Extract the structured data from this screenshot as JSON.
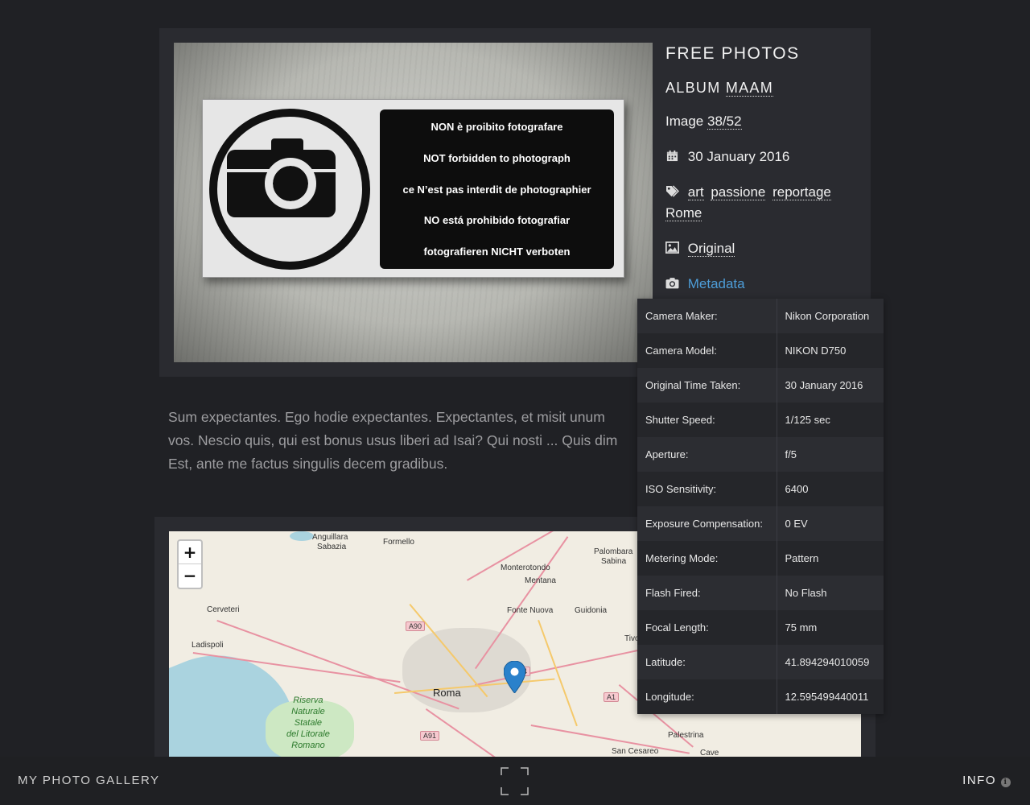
{
  "photo": {
    "sign_lines": [
      "NON è proibito fotografare",
      "NOT forbidden to photograph",
      "ce N’est pas interdit de photographier",
      "NO está prohibido fotografiar",
      "fotografieren NICHT verboten"
    ]
  },
  "info": {
    "site_title": "FREE PHOTOS",
    "album_prefix": "ALBUM",
    "album_name": "MAAM",
    "image_prefix": "Image",
    "image_counter": "38/52",
    "date": "30 January 2016",
    "tags": [
      "art",
      "passione",
      "reportage",
      "Rome"
    ],
    "original_label": "Original",
    "metadata_label": "Metadata",
    "link_color": "#4d9dd8"
  },
  "description": {
    "lines": [
      "Sum expectantes. Ego hodie expectantes. Expectantes, et misit unum",
      "vos. Nescio quis, qui est bonus usus liberi ad Isai? Qui nosti ... Quis dim",
      "Est, ante me factus singulis decem gradibus."
    ]
  },
  "metadata": [
    {
      "key": "Camera Maker:",
      "value": "Nikon Corporation"
    },
    {
      "key": "Camera Model:",
      "value": "NIKON D750"
    },
    {
      "key": "Original Time Taken:",
      "value": "30 January 2016"
    },
    {
      "key": "Shutter Speed:",
      "value": "1/125 sec"
    },
    {
      "key": "Aperture:",
      "value": "f/5"
    },
    {
      "key": "ISO Sensitivity:",
      "value": "6400"
    },
    {
      "key": "Exposure Compensation:",
      "value": "0 EV"
    },
    {
      "key": "Metering Mode:",
      "value": "Pattern"
    },
    {
      "key": "Flash Fired:",
      "value": "No Flash"
    },
    {
      "key": "Focal Length:",
      "value": "75 mm"
    },
    {
      "key": "Latitude:",
      "value": "41.894294010059"
    },
    {
      "key": "Longitude:",
      "value": "12.595499440011"
    }
  ],
  "map": {
    "zoom_in": "+",
    "zoom_out": "−",
    "labels": {
      "anguillara": "Anguillara",
      "sabazia": "Sabazia",
      "formello": "Formello",
      "palombara": "Palombara",
      "sabina": "Sabina",
      "monterotondo": "Monterotondo",
      "mentana": "Mentana",
      "cerveteri": "Cerveteri",
      "fonte_nuova": "Fonte Nuova",
      "guidonia": "Guidonia",
      "tivoli": "Tivo",
      "ladispoli": "Ladispoli",
      "roma": "Roma",
      "riserva": "Riserva",
      "naturale": "Naturale",
      "statale": "Statale",
      "del_litorale": "del Litorale",
      "romano": "Romano",
      "palestrina": "Palestrina",
      "san_cesareo": "San Cesareo",
      "cave": "Cave"
    },
    "shields": {
      "a90": "A90",
      "a1": "A1",
      "a91": "A91",
      "a24": "4"
    }
  },
  "footer": {
    "gallery_title": "MY PHOTO GALLERY",
    "info_label": "INFO",
    "info_icon": "i"
  }
}
